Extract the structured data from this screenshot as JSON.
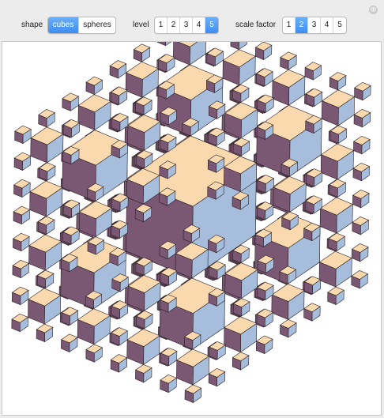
{
  "window": {
    "close_glyph": "⊕"
  },
  "controls": {
    "shape": {
      "label": "shape",
      "options": [
        "cubes",
        "spheres"
      ],
      "selected": "cubes"
    },
    "level": {
      "label": "level",
      "options": [
        "1",
        "2",
        "3",
        "4",
        "5"
      ],
      "selected": "5"
    },
    "scale": {
      "label": "scale factor",
      "options": [
        "1",
        "2",
        "3",
        "4",
        "5"
      ],
      "selected": "2"
    }
  },
  "colors": {
    "accent": "#4a90f0",
    "top_face": "#fbd9ae",
    "left_face": "#7a5773",
    "right_face": "#a6bedc",
    "outline": "#2a1f24"
  },
  "render": {
    "shape": "cubes",
    "level": 5,
    "scale_factor": 2
  }
}
